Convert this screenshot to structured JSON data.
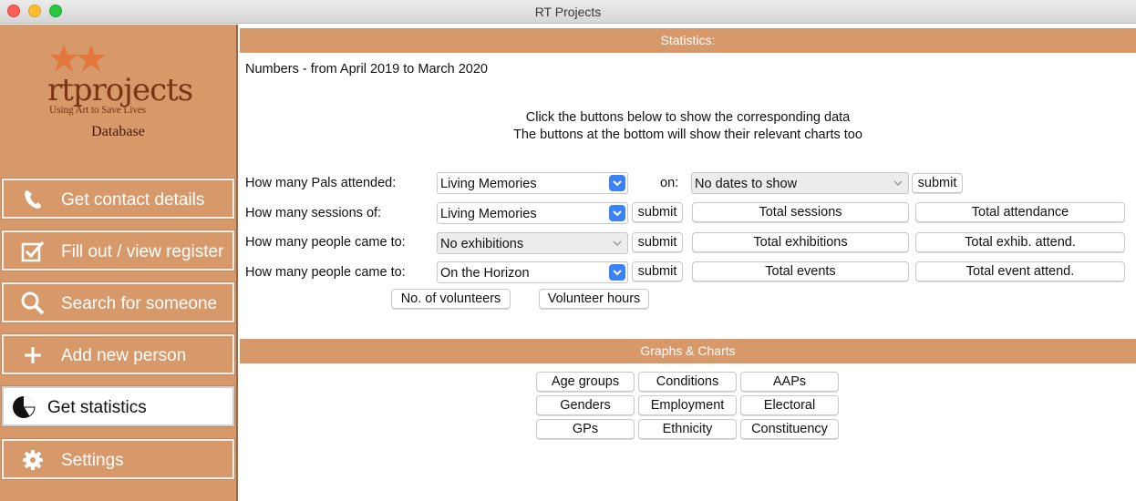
{
  "window": {
    "title": "RT Projects"
  },
  "sidebar": {
    "logo": {
      "text": "rtprojects",
      "tagline": "Using Art to Save Lives",
      "subtitle": "Database"
    },
    "items": [
      {
        "label": "Get contact details",
        "icon": "phone-icon"
      },
      {
        "label": "Fill out / view register",
        "icon": "checkbox-icon"
      },
      {
        "label": "Search for someone",
        "icon": "search-icon"
      },
      {
        "label": "Add new person",
        "icon": "plus-icon"
      },
      {
        "label": "Get statistics",
        "icon": "pie-chart-icon",
        "active": true
      },
      {
        "label": "Settings",
        "icon": "gear-icon"
      }
    ]
  },
  "statistics": {
    "header": "Statistics:",
    "period": "Numbers - from April 2019 to March 2020",
    "instruction_1": "Click the buttons below to show the corresponding data",
    "instruction_2": "The buttons at the bottom will show their relevant charts too",
    "rows": [
      {
        "label": "How many Pals attended:",
        "combo": "Living Memories",
        "on_label": "on:",
        "date_combo": "No dates to show",
        "submit": "submit"
      },
      {
        "label": "How many sessions of:",
        "combo": "Living Memories",
        "submit": "submit",
        "total_1": "Total sessions",
        "total_2": "Total attendance"
      },
      {
        "label": "How many people came to:",
        "combo": "No exhibitions",
        "submit": "submit",
        "total_1": "Total exhibitions",
        "total_2": "Total exhib. attend."
      },
      {
        "label": "How many people came to:",
        "combo": "On the Horizon",
        "submit": "submit",
        "total_1": "Total events",
        "total_2": "Total event attend."
      }
    ],
    "volunteers_button": "No. of volunteers",
    "volunteer_hours_button": "Volunteer hours"
  },
  "graphs": {
    "header": "Graphs & Charts",
    "buttons": [
      "Age groups",
      "Conditions",
      "AAPs",
      "Genders",
      "Employment",
      "Electoral",
      "GPs",
      "Ethnicity",
      "Constituency"
    ]
  },
  "colors": {
    "accent": "#d8996a",
    "logo_text": "#7a3414",
    "combo_arrow": "#3b82f6"
  }
}
